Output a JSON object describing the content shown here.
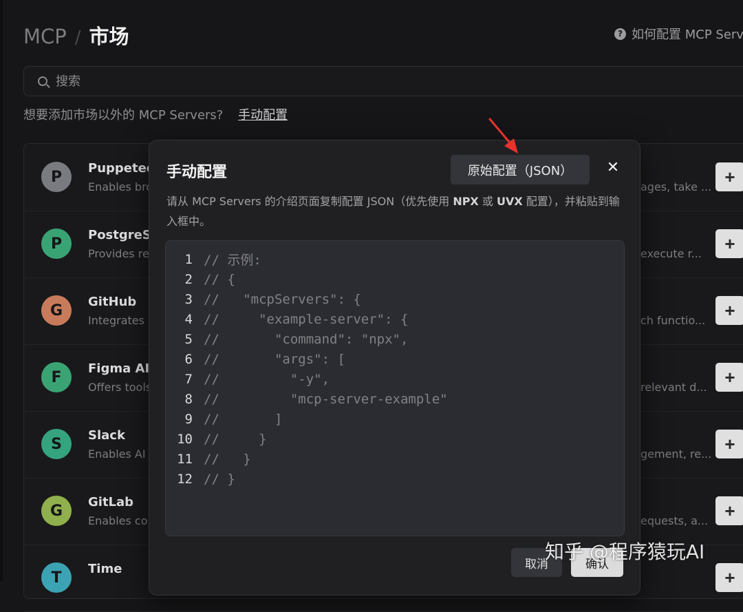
{
  "header": {
    "breadcrumb_root": "MCP",
    "breadcrumb_separator": "/",
    "breadcrumb_current": "市场",
    "help_link": "如何配置 MCP Servers"
  },
  "search": {
    "placeholder": "搜索"
  },
  "hint": {
    "text": "想要添加市场以外的 MCP Servers?",
    "link": "手动配置"
  },
  "servers": [
    {
      "initial": "P",
      "name": "Puppeteer",
      "desc_start": "Enables bro",
      "desc_end": "ages, take ...",
      "color": "#7a7b80"
    },
    {
      "initial": "P",
      "name": "PostgreSQL",
      "desc_start": "Provides re",
      "desc_end": "execute r...",
      "color": "#3aa374"
    },
    {
      "initial": "G",
      "name": "GitHub",
      "desc_start": "Integrates w",
      "desc_end": "ch functio...",
      "color": "#c87b5a"
    },
    {
      "initial": "F",
      "name": "Figma AI Bridge",
      "desc_start": "Offers tools",
      "desc_end": "relevant d...",
      "color": "#3aa374"
    },
    {
      "initial": "S",
      "name": "Slack",
      "desc_start": "Enables AI",
      "desc_end": "gement, re...",
      "color": "#35a37e"
    },
    {
      "initial": "G",
      "name": "GitLab",
      "desc_start": "Enables cor",
      "desc_end": "equests, a...",
      "color": "#8fb04c"
    },
    {
      "initial": "T",
      "name": "Time",
      "desc_start": "",
      "desc_end": "",
      "color": "#3ba3b3"
    }
  ],
  "add_label": "+",
  "modal": {
    "title": "手动配置",
    "json_button": "原始配置（JSON）",
    "close_label": "✕",
    "description": {
      "part1": "请从 MCP Servers 的介绍页面复制配置 JSON（优先使用 ",
      "npx": "NPX",
      "or": " 或 ",
      "uvx": "UVX",
      "part2": " 配置），并粘贴到输入框中。"
    },
    "code_lines": [
      {
        "num": "1",
        "text": "// 示例:"
      },
      {
        "num": "2",
        "text": "// {"
      },
      {
        "num": "3",
        "text": "//   \"mcpServers\": {"
      },
      {
        "num": "4",
        "text": "//     \"example-server\": {"
      },
      {
        "num": "5",
        "text": "//       \"command\": \"npx\","
      },
      {
        "num": "6",
        "text": "//       \"args\": ["
      },
      {
        "num": "7",
        "text": "//         \"-y\","
      },
      {
        "num": "8",
        "text": "//         \"mcp-server-example\""
      },
      {
        "num": "9",
        "text": "//       ]"
      },
      {
        "num": "10",
        "text": "//     }"
      },
      {
        "num": "11",
        "text": "//   }"
      },
      {
        "num": "12",
        "text": "// }"
      }
    ],
    "cancel": "取消",
    "confirm": "确认"
  },
  "watermark": "知乎 @程序猿玩AI",
  "colors": {
    "background": "#161618",
    "modal_bg": "#202023",
    "editor_bg": "#2b2c31",
    "arrow": "#e8322d"
  }
}
